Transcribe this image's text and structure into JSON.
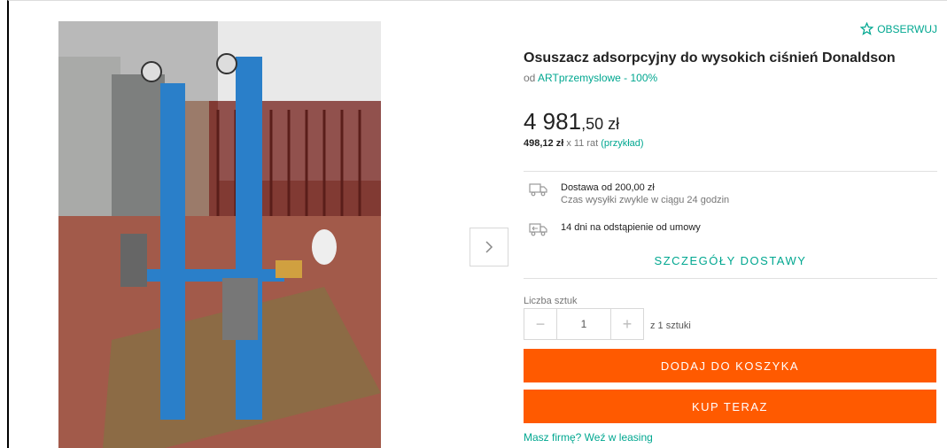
{
  "watch": {
    "label": "OBSERWUJ",
    "icon": "star-outline-icon"
  },
  "product": {
    "title": "Osuszacz adsorpcyjny do wysokich ciśnień Donaldson",
    "seller_prefix": "od",
    "seller_name": "ARTprzemyslowe - 100%"
  },
  "price": {
    "main": "4 981",
    "cents": ",50 zł"
  },
  "installment": {
    "amount": "498,12 zł",
    "count_text": "x 11 rat",
    "example_link": "(przykład)"
  },
  "delivery": {
    "cost": "Dostawa od 200,00 zł",
    "time": "Czas wysyłki zwykle w ciągu 24 godzin",
    "returns": "14 dni na odstąpienie od umowy",
    "details_link": "SZCZEGÓŁY DOSTAWY"
  },
  "quantity": {
    "label": "Liczba sztuk",
    "value": "1",
    "minus": "−",
    "plus": "+",
    "of_units": "z 1 sztuki"
  },
  "actions": {
    "add_to_cart": "DODAJ DO KOSZYKA",
    "buy_now": "KUP TERAZ",
    "leasing": "Masz firmę? Weź w leasing"
  },
  "colors": {
    "accent": "#00a790",
    "cta": "#ff5a00"
  }
}
